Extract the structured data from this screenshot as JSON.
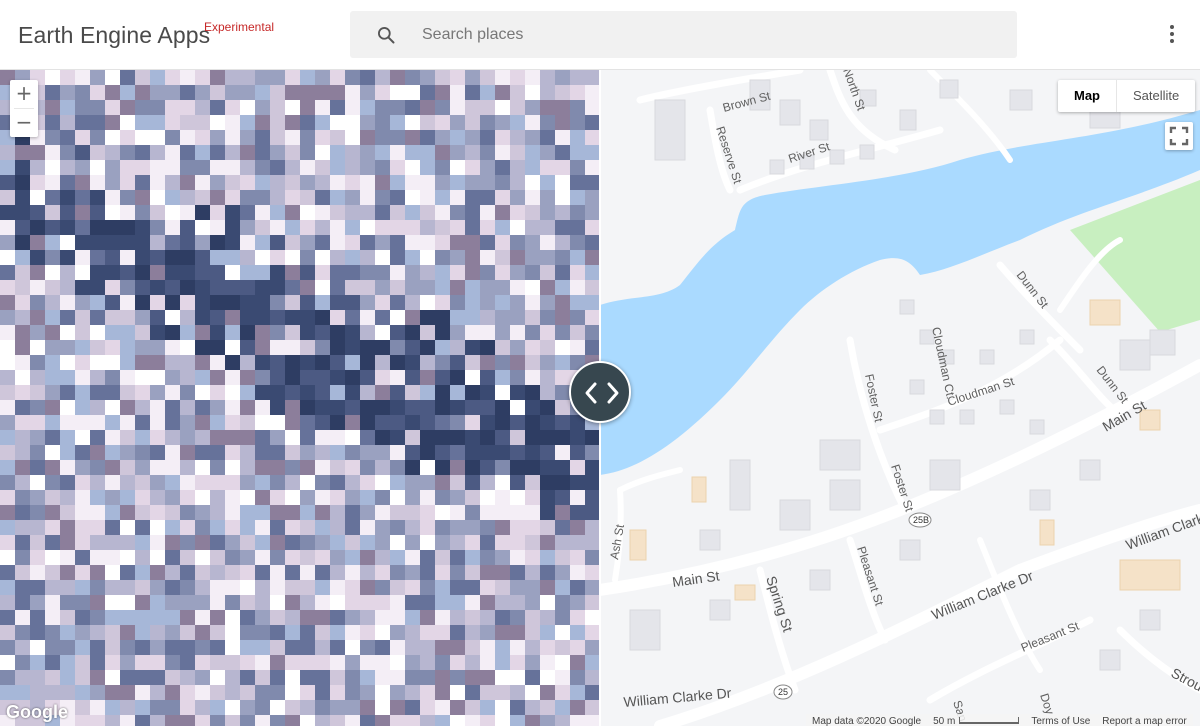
{
  "header": {
    "title": "Earth Engine Apps",
    "badge": "Experimental",
    "search": {
      "placeholder": "Search places",
      "value": ""
    }
  },
  "zoom": {
    "in_label": "+",
    "out_label": "−"
  },
  "map_type": {
    "options": [
      "Map",
      "Satellite"
    ],
    "selected": "Map"
  },
  "streets": {
    "brown": "Brown St",
    "north": "North St",
    "reserve": "Reserve St",
    "river": "River St",
    "dunn_top": "Dunn St",
    "dunn_mid": "Dunn St",
    "cloudman_ct": "Cloudman Ct.",
    "cloudman_st": "Cloudman St",
    "foster_a": "Foster St",
    "foster_b": "Foster St",
    "main_right": "Main St",
    "main_left": "Main St",
    "ash": "Ash St",
    "spring": "Spring St",
    "pleasant_a": "Pleasant St",
    "pleasant_b": "Pleasant St",
    "william_1": "William Clarke Dr",
    "william_2": "William Clarke Dr",
    "william_3": "William Clarke Dr",
    "william_4": "William Clark",
    "strou": "Strou",
    "san": "San",
    "doy": "Doy"
  },
  "shields": {
    "route_a": "25B",
    "route_b": "25"
  },
  "google_logo": "Google",
  "attribution": {
    "map_data": "Map data ©2020 Google",
    "scale": "50 m",
    "terms": "Terms of Use",
    "report": "Report a map error"
  },
  "colors": {
    "water": "#aadaff",
    "park": "#c8efc0",
    "road": "#ffffff",
    "building": "#e8e8ec",
    "handle": "#37474f",
    "badge": "#c62828"
  }
}
